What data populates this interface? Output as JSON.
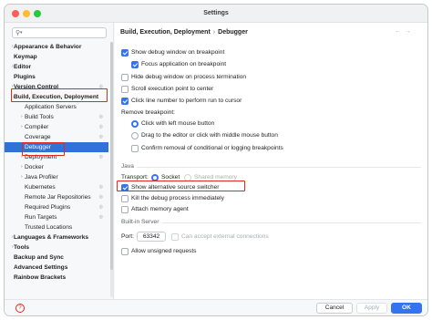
{
  "window": {
    "title": "Settings"
  },
  "search": {
    "value": "",
    "placeholder": ""
  },
  "sidebar": {
    "items": [
      {
        "label": "Appearance & Behavior",
        "arrow": "›",
        "bold": true,
        "gear": false
      },
      {
        "label": "Keymap",
        "arrow": "",
        "bold": true,
        "gear": false
      },
      {
        "label": "Editor",
        "arrow": "›",
        "bold": true,
        "gear": false
      },
      {
        "label": "Plugins",
        "arrow": "",
        "bold": true,
        "gear": false
      },
      {
        "label": "Version Control",
        "arrow": "›",
        "bold": true,
        "gear": true
      },
      {
        "label": "Build, Execution, Deployment",
        "arrow": "⌄",
        "bold": true,
        "gear": false
      },
      {
        "label": "Application Servers",
        "arrow": "",
        "bold": false,
        "gear": false
      },
      {
        "label": "Build Tools",
        "arrow": "›",
        "bold": false,
        "gear": true
      },
      {
        "label": "Compiler",
        "arrow": "›",
        "bold": false,
        "gear": true
      },
      {
        "label": "Coverage",
        "arrow": "",
        "bold": false,
        "gear": true
      },
      {
        "label": "Debugger",
        "arrow": "",
        "bold": false,
        "gear": false
      },
      {
        "label": "Deployment",
        "arrow": "›",
        "bold": false,
        "gear": true
      },
      {
        "label": "Docker",
        "arrow": "›",
        "bold": false,
        "gear": false
      },
      {
        "label": "Java Profiler",
        "arrow": "›",
        "bold": false,
        "gear": false
      },
      {
        "label": "Kubernetes",
        "arrow": "",
        "bold": false,
        "gear": true
      },
      {
        "label": "Remote Jar Repositories",
        "arrow": "",
        "bold": false,
        "gear": true
      },
      {
        "label": "Required Plugins",
        "arrow": "",
        "bold": false,
        "gear": true
      },
      {
        "label": "Run Targets",
        "arrow": "",
        "bold": false,
        "gear": true
      },
      {
        "label": "Trusted Locations",
        "arrow": "",
        "bold": false,
        "gear": false
      },
      {
        "label": "Languages & Frameworks",
        "arrow": "›",
        "bold": true,
        "gear": false
      },
      {
        "label": "Tools",
        "arrow": "›",
        "bold": true,
        "gear": false
      },
      {
        "label": "Backup and Sync",
        "arrow": "",
        "bold": true,
        "gear": false
      },
      {
        "label": "Advanced Settings",
        "arrow": "",
        "bold": true,
        "gear": false
      },
      {
        "label": "Rainbow Brackets",
        "arrow": "",
        "bold": true,
        "gear": false
      }
    ],
    "selected_label": "Debugger"
  },
  "breadcrumb": {
    "parent": "Build, Execution, Deployment",
    "separator": "›",
    "current": "Debugger"
  },
  "nav": {
    "back": "←",
    "forward": "→"
  },
  "debugger": {
    "show_debug_window": {
      "label": "Show debug window on breakpoint",
      "checked": true
    },
    "focus_application": {
      "label": "Focus application on breakpoint",
      "checked": true
    },
    "hide_debug_window": {
      "label": "Hide debug window on process termination",
      "checked": false
    },
    "scroll_execution": {
      "label": "Scroll execution point to center",
      "checked": false
    },
    "click_line_number": {
      "label": "Click line number to perform run to cursor",
      "checked": true
    },
    "remove_breakpoint_label": "Remove breakpoint:",
    "remove_click": {
      "label": "Click with left mouse button",
      "selected": true
    },
    "remove_drag": {
      "label": "Drag to the editor or click with middle mouse button",
      "selected": false
    },
    "confirm_removal": {
      "label": "Confirm removal of conditional or logging breakpoints",
      "checked": false
    }
  },
  "java": {
    "section": "Java",
    "transport_label": "Transport:",
    "socket": {
      "label": "Socket",
      "selected": true
    },
    "shared_memory": {
      "label": "Shared memory",
      "selected": false
    },
    "show_alt_source": {
      "label": "Show alternative source switcher",
      "checked": true
    },
    "kill_process": {
      "label": "Kill the debug process immediately",
      "checked": false
    },
    "attach_memory": {
      "label": "Attach memory agent",
      "checked": false
    }
  },
  "builtin": {
    "section": "Built-in Server",
    "port_label": "Port:",
    "port_value": "63342",
    "accept_external": {
      "label": "Can accept external connections",
      "checked": false
    },
    "allow_unsigned": {
      "label": "Allow unsigned requests",
      "checked": false
    }
  },
  "footer": {
    "help": "?",
    "cancel": "Cancel",
    "apply": "Apply",
    "ok": "OK"
  },
  "colors": {
    "accent": "#3574f0",
    "highlight": "#e0291f",
    "selection": "#2f73da"
  }
}
